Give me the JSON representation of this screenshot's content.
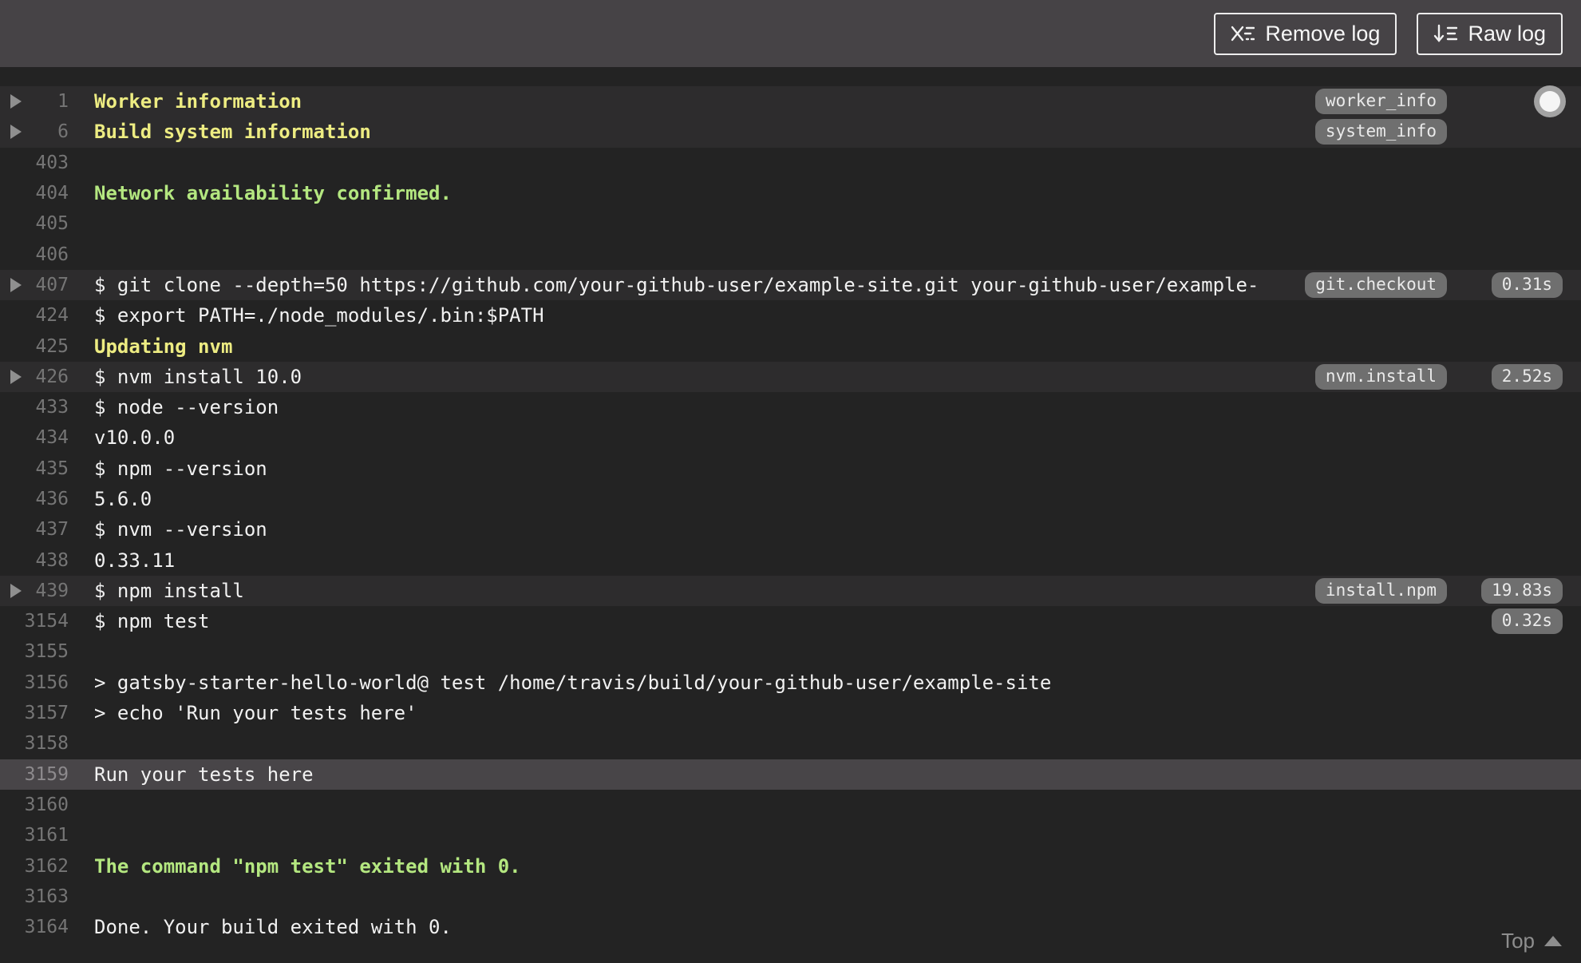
{
  "toolbar": {
    "remove_log_label": "Remove log",
    "raw_log_label": "Raw log"
  },
  "log": {
    "rows": [
      {
        "line": "1",
        "text": "Worker information",
        "style": "yellow",
        "fold": true,
        "highlight": true,
        "tag": "worker_info"
      },
      {
        "line": "6",
        "text": "Build system information",
        "style": "yellow",
        "fold": true,
        "highlight": true,
        "tag": "system_info"
      },
      {
        "line": "403",
        "text": "",
        "style": "plain"
      },
      {
        "line": "404",
        "text": "Network availability confirmed.",
        "style": "green"
      },
      {
        "line": "405",
        "text": "",
        "style": "plain"
      },
      {
        "line": "406",
        "text": "",
        "style": "plain"
      },
      {
        "line": "407",
        "text": "$ git clone --depth=50 https://github.com/your-github-user/example-site.git your-github-user/example-",
        "style": "plain",
        "fold": true,
        "highlight": true,
        "tag": "git.checkout",
        "time": "0.31s"
      },
      {
        "line": "424",
        "text": "$ export PATH=./node_modules/.bin:$PATH",
        "style": "plain"
      },
      {
        "line": "425",
        "text": "Updating nvm",
        "style": "yellow"
      },
      {
        "line": "426",
        "text": "$ nvm install 10.0",
        "style": "plain",
        "fold": true,
        "highlight": true,
        "tag": "nvm.install",
        "time": "2.52s"
      },
      {
        "line": "433",
        "text": "$ node --version",
        "style": "plain"
      },
      {
        "line": "434",
        "text": "v10.0.0",
        "style": "plain"
      },
      {
        "line": "435",
        "text": "$ npm --version",
        "style": "plain"
      },
      {
        "line": "436",
        "text": "5.6.0",
        "style": "plain"
      },
      {
        "line": "437",
        "text": "$ nvm --version",
        "style": "plain"
      },
      {
        "line": "438",
        "text": "0.33.11",
        "style": "plain"
      },
      {
        "line": "439",
        "text": "$ npm install",
        "style": "plain",
        "fold": true,
        "highlight": true,
        "tag": "install.npm",
        "time": "19.83s"
      },
      {
        "line": "3154",
        "text": "$ npm test",
        "style": "plain",
        "time": "0.32s"
      },
      {
        "line": "3155",
        "text": "",
        "style": "plain"
      },
      {
        "line": "3156",
        "text": "> gatsby-starter-hello-world@ test /home/travis/build/your-github-user/example-site",
        "style": "plain"
      },
      {
        "line": "3157",
        "text": "> echo 'Run your tests here'",
        "style": "plain"
      },
      {
        "line": "3158",
        "text": "",
        "style": "plain"
      },
      {
        "line": "3159",
        "text": "Run your tests here",
        "style": "plain",
        "selected": true
      },
      {
        "line": "3160",
        "text": "",
        "style": "plain"
      },
      {
        "line": "3161",
        "text": "",
        "style": "plain"
      },
      {
        "line": "3162",
        "text": "The command \"npm test\" exited with 0.",
        "style": "green"
      },
      {
        "line": "3163",
        "text": "",
        "style": "plain"
      },
      {
        "line": "3164",
        "text": "Done. Your build exited with 0.",
        "style": "plain"
      }
    ],
    "top_link_label": "Top"
  },
  "colors": {
    "toolbar_bg": "#464346",
    "log_bg": "#232323",
    "fold_row_bg": "#2d2c2d",
    "selected_row_bg": "#484548",
    "yellow_text": "#edec82",
    "green_text": "#b4e780",
    "plain_text": "#f1f1f1",
    "line_number": "#757575",
    "pill_bg": "#6f6f6f",
    "pill_text": "#eaeaea"
  }
}
